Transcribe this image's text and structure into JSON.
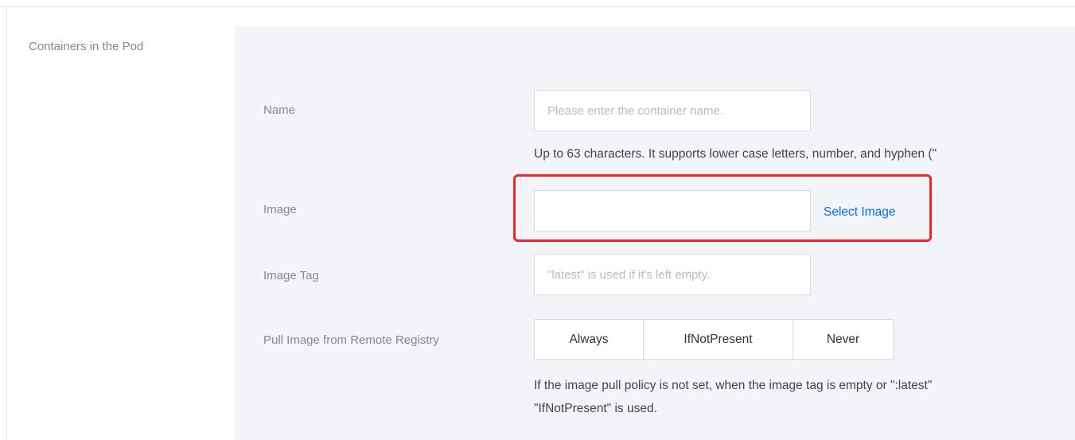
{
  "section": {
    "label": "Containers in the Pod"
  },
  "form": {
    "name": {
      "label": "Name",
      "placeholder": "Please enter the container name.",
      "value": "",
      "help": "Up to 63 characters. It supports lower case letters, number, and hyphen (\""
    },
    "image": {
      "label": "Image",
      "value": "",
      "select_label": "Select Image"
    },
    "image_tag": {
      "label": "Image Tag",
      "placeholder": "\"latest\" is used if it's left empty.",
      "value": ""
    },
    "pull_policy": {
      "label": "Pull Image from Remote Registry",
      "options": [
        "Always",
        "IfNotPresent",
        "Never"
      ],
      "help_line1": "If the image pull policy is not set, when the image tag is empty or \":latest\"",
      "help_line2": "\"IfNotPresent\" is used."
    }
  },
  "colors": {
    "panel_background": "#f3f4f7",
    "link": "#006eff",
    "highlight": "#f0262b"
  }
}
